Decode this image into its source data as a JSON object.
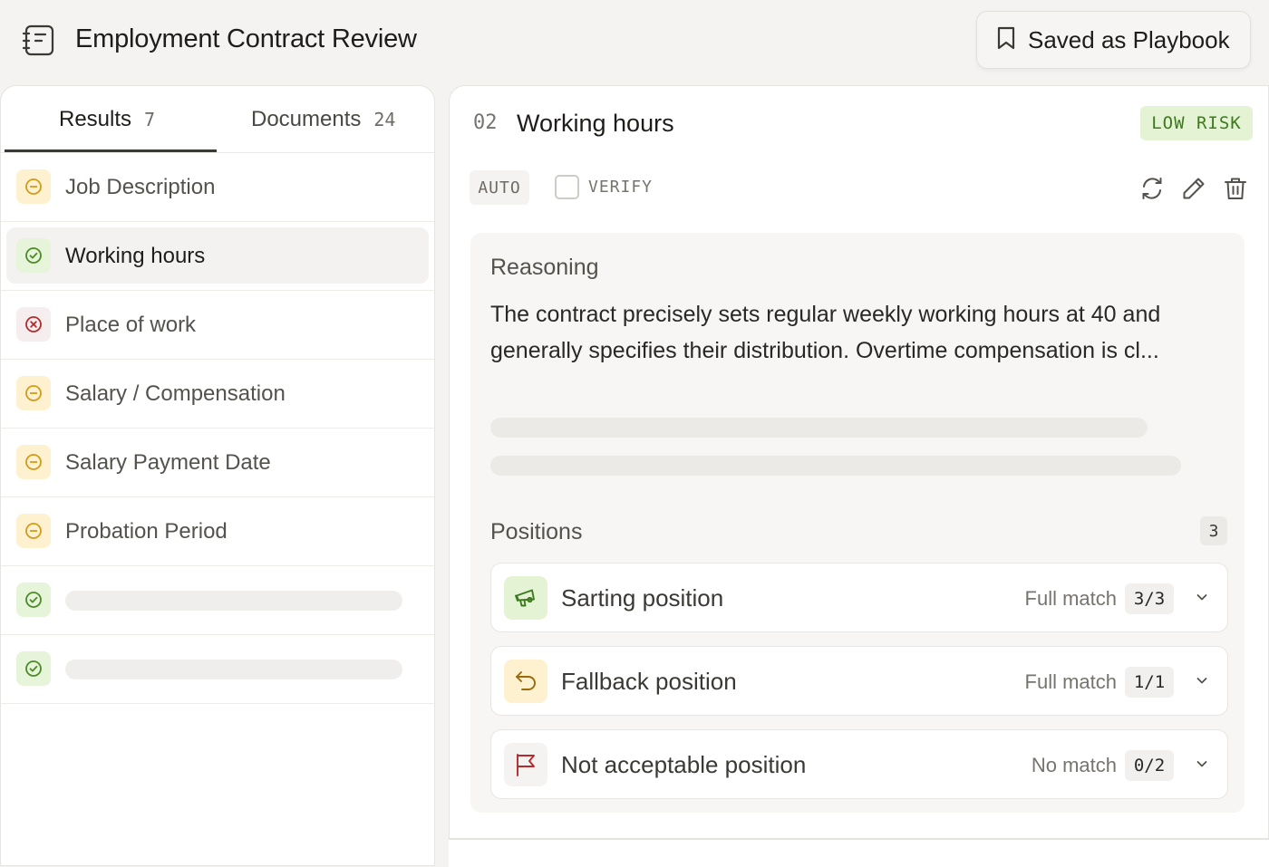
{
  "header": {
    "title": "Employment Contract Review",
    "saved_button": "Saved as Playbook"
  },
  "tabs": [
    {
      "label": "Results",
      "count": "7"
    },
    {
      "label": "Documents",
      "count": "24"
    }
  ],
  "results": [
    {
      "label": "Job Description",
      "status": "warning"
    },
    {
      "label": "Working hours",
      "status": "ok",
      "selected": true
    },
    {
      "label": "Place of work",
      "status": "error"
    },
    {
      "label": "Salary / Compensation",
      "status": "warning"
    },
    {
      "label": "Salary Payment Date",
      "status": "warning"
    },
    {
      "label": "Probation Period",
      "status": "warning"
    },
    {
      "label": "",
      "status": "ok",
      "loading": true
    },
    {
      "label": "",
      "status": "ok",
      "loading": true
    }
  ],
  "detail": {
    "number": "02",
    "title": "Working hours",
    "risk": "LOW RISK",
    "auto_tag": "AUTO",
    "verify_label": "VERIFY",
    "reasoning_heading": "Reasoning",
    "reasoning_text": "The contract precisely sets regular weekly working hours at 40 and generally specifies their distribution. Overtime compensation is cl...",
    "positions_heading": "Positions",
    "positions_count": "3",
    "positions": [
      {
        "label": "Sarting position",
        "match": "Full match",
        "score": "3/3",
        "icon": "megaphone-icon"
      },
      {
        "label": "Fallback position",
        "match": "Full match",
        "score": "1/1",
        "icon": "undo-arrow-icon"
      },
      {
        "label": "Not acceptable position",
        "match": "No match",
        "score": "0/2",
        "icon": "flag-icon"
      }
    ]
  },
  "colors": {
    "warning": "#e0a520",
    "ok": "#4c8a2a",
    "error": "#b42b2b",
    "risk_low_bg": "#e3f3d3",
    "risk_low_text": "#3d7a1e"
  }
}
